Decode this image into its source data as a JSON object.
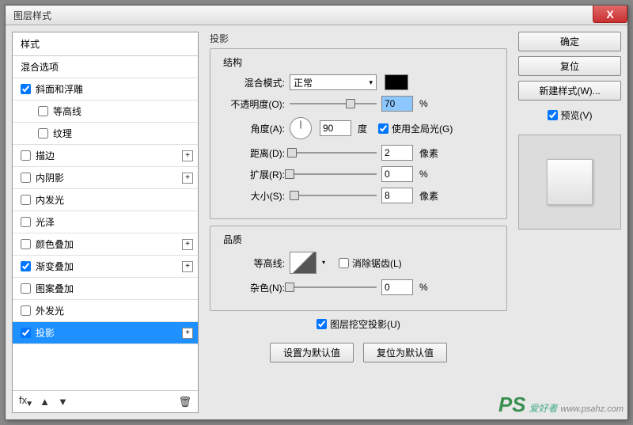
{
  "title": "图层样式",
  "leftPanel": {
    "header": "样式",
    "blendOptions": "混合选项",
    "items": [
      {
        "label": "斜面和浮雕",
        "checked": true,
        "hasPlus": false,
        "indent": false
      },
      {
        "label": "等高线",
        "checked": false,
        "hasPlus": false,
        "indent": true
      },
      {
        "label": "纹理",
        "checked": false,
        "hasPlus": false,
        "indent": true
      },
      {
        "label": "描边",
        "checked": false,
        "hasPlus": true,
        "indent": false
      },
      {
        "label": "内阴影",
        "checked": false,
        "hasPlus": true,
        "indent": false
      },
      {
        "label": "内发光",
        "checked": false,
        "hasPlus": false,
        "indent": false
      },
      {
        "label": "光泽",
        "checked": false,
        "hasPlus": false,
        "indent": false
      },
      {
        "label": "颜色叠加",
        "checked": false,
        "hasPlus": true,
        "indent": false
      },
      {
        "label": "渐变叠加",
        "checked": true,
        "hasPlus": true,
        "indent": false
      },
      {
        "label": "图案叠加",
        "checked": false,
        "hasPlus": false,
        "indent": false
      },
      {
        "label": "外发光",
        "checked": false,
        "hasPlus": false,
        "indent": false
      },
      {
        "label": "投影",
        "checked": true,
        "hasPlus": true,
        "indent": false,
        "selected": true
      }
    ]
  },
  "middle": {
    "sectionTitle": "投影",
    "structure": {
      "title": "结构",
      "blendModeLabel": "混合模式:",
      "blendModeValue": "正常",
      "opacityLabel": "不透明度(O):",
      "opacityValue": "70",
      "opacityUnit": "%",
      "angleLabel": "角度(A):",
      "angleValue": "90",
      "angleUnit": "度",
      "globalLight": "使用全局光(G)",
      "distanceLabel": "距离(D):",
      "distanceValue": "2",
      "distanceUnit": "像素",
      "spreadLabel": "扩展(R):",
      "spreadValue": "0",
      "spreadUnit": "%",
      "sizeLabel": "大小(S):",
      "sizeValue": "8",
      "sizeUnit": "像素"
    },
    "quality": {
      "title": "品质",
      "contourLabel": "等高线:",
      "antiAlias": "消除锯齿(L)",
      "noiseLabel": "杂色(N):",
      "noiseValue": "0",
      "noiseUnit": "%"
    },
    "knockout": "图层挖空投影(U)",
    "setDefault": "设置为默认值",
    "resetDefault": "复位为默认值"
  },
  "right": {
    "ok": "确定",
    "reset": "复位",
    "newStyle": "新建样式(W)...",
    "preview": "预览(V)"
  },
  "watermark": {
    "ps": "PS",
    "text": "爱好者",
    "url": "www.psahz.com"
  }
}
